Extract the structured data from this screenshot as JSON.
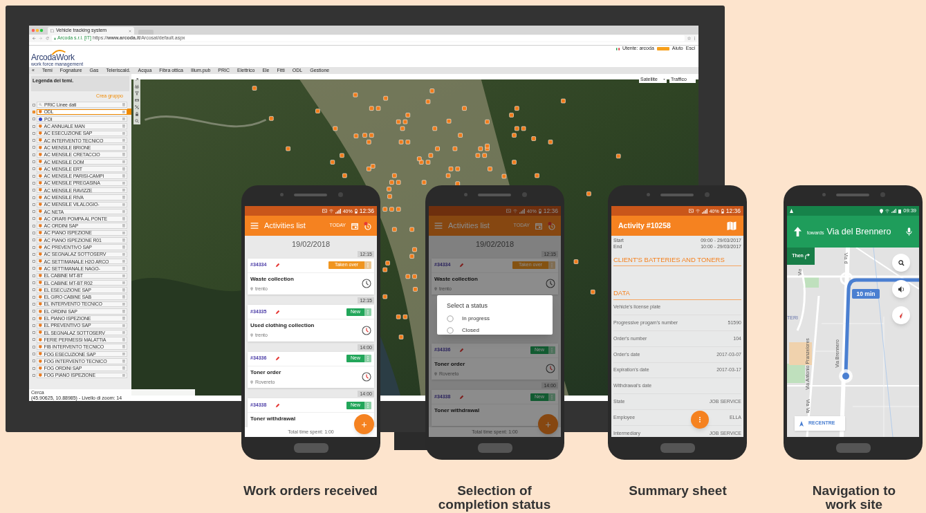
{
  "desktop": {
    "browser_tab": "Vehicle tracking system",
    "site_identity": "Arcoda s.r.l. [IT]",
    "url": "https://**www.arcoda.it**/Arcosat/default.aspx",
    "user_label": "Utente: arcoda",
    "help": "Aiuto",
    "exit": "Esci",
    "logo": {
      "name": "Arcoda",
      "product": "Work",
      "tagline": "work force management"
    },
    "menu": [
      "«",
      "Temi",
      "Fognature",
      "Gas",
      "Teleriscald.",
      "Acqua",
      "Fibra ottica",
      "Illum.pub",
      "PRIC",
      "Elettrico",
      "Ele",
      "Fitti",
      "ODL",
      "Gestione"
    ],
    "legend_title": "Legenda dei temi.",
    "create_group": "Crea gruppo",
    "layers": [
      {
        "label": "PRIC Linee dati",
        "kind": "search",
        "checked": false,
        "selected": false
      },
      {
        "label": "ODL",
        "kind": "marker",
        "checked": true,
        "selected": true
      },
      {
        "label": "POI",
        "kind": "dot",
        "color": "#2b3fc4",
        "checked": false,
        "selected": false
      },
      {
        "label": "AC ANNUALE MAN",
        "kind": "marker",
        "checked": false,
        "selected": false
      },
      {
        "label": "AC ESECUZIONE SAP",
        "kind": "marker",
        "checked": false,
        "selected": false
      },
      {
        "label": "AC INTERVENTO TECNICO",
        "kind": "marker",
        "checked": false,
        "selected": false
      },
      {
        "label": "AC MENSILE BRIONE",
        "kind": "marker",
        "checked": false,
        "selected": false
      },
      {
        "label": "AC MENSILE CRETACCIO",
        "kind": "marker",
        "checked": false,
        "selected": false
      },
      {
        "label": "AC MENSILE DOM",
        "kind": "marker",
        "checked": false,
        "selected": false
      },
      {
        "label": "AC MENSILE ERT",
        "kind": "marker",
        "checked": false,
        "selected": false
      },
      {
        "label": "AC MENSILE PARISI-CAMPI",
        "kind": "marker",
        "checked": false,
        "selected": false
      },
      {
        "label": "AC MENSILE PREGASINA",
        "kind": "marker",
        "checked": false,
        "selected": false
      },
      {
        "label": "AC MENSILE RAVIZZE",
        "kind": "marker",
        "checked": false,
        "selected": false
      },
      {
        "label": "AC MENSILE RIVA",
        "kind": "marker",
        "checked": false,
        "selected": false
      },
      {
        "label": "AC MENSILE VILALOGIO-",
        "kind": "marker",
        "checked": false,
        "selected": false
      },
      {
        "label": "AC NETA",
        "kind": "marker",
        "checked": false,
        "selected": false
      },
      {
        "label": "AC ORARI POMPA AL PONTE",
        "kind": "marker",
        "checked": false,
        "selected": false
      },
      {
        "label": "AC ORDINI SAP",
        "kind": "marker",
        "checked": false,
        "selected": false
      },
      {
        "label": "AC PIANO ISPEZIONE",
        "kind": "marker",
        "checked": false,
        "selected": false
      },
      {
        "label": "AC PIANO ISPEZIONE R01",
        "kind": "marker",
        "checked": false,
        "selected": false
      },
      {
        "label": "AC PREVENTIVO SAP",
        "kind": "marker",
        "checked": false,
        "selected": false
      },
      {
        "label": "AC SEGNALAZ SOTTOSERV",
        "kind": "marker",
        "checked": false,
        "selected": false
      },
      {
        "label": "AC SETTIMANALE H2O ARCO",
        "kind": "marker",
        "checked": false,
        "selected": false
      },
      {
        "label": "AC SETTIMANALE NAGO-",
        "kind": "marker",
        "checked": false,
        "selected": false
      },
      {
        "label": "EL CABINE MT-BT",
        "kind": "marker",
        "checked": false,
        "selected": false
      },
      {
        "label": "EL CABINE MT-BT R02",
        "kind": "marker",
        "checked": false,
        "selected": false
      },
      {
        "label": "EL ESECUZIONE SAP",
        "kind": "marker",
        "checked": false,
        "selected": false
      },
      {
        "label": "EL GIRO CABINE SAB",
        "kind": "marker",
        "checked": false,
        "selected": false
      },
      {
        "label": "EL INTERVENTO TECNICO",
        "kind": "marker",
        "checked": false,
        "selected": false
      },
      {
        "label": "EL ORDINI SAP",
        "kind": "marker",
        "checked": false,
        "selected": false
      },
      {
        "label": "EL PIANO ISPEZIONE",
        "kind": "marker",
        "checked": false,
        "selected": false
      },
      {
        "label": "EL PREVENTIVO SAP",
        "kind": "marker",
        "checked": false,
        "selected": false
      },
      {
        "label": "EL SEGNALAZ SOTTOSERV",
        "kind": "marker",
        "checked": false,
        "selected": false
      },
      {
        "label": "FERIE PERMESSI MALATTIA",
        "kind": "marker",
        "checked": false,
        "selected": false
      },
      {
        "label": "FIB INTERVENTO TECNICO",
        "kind": "marker",
        "checked": false,
        "selected": false
      },
      {
        "label": "FOG ESECUZIONE SAP",
        "kind": "marker",
        "checked": false,
        "selected": false
      },
      {
        "label": "FOG INTERVENTO TECNICO",
        "kind": "marker",
        "checked": false,
        "selected": false
      },
      {
        "label": "FOG ORDINI SAP",
        "kind": "marker",
        "checked": false,
        "selected": false
      },
      {
        "label": "FOG PIANO ISPEZIONE",
        "kind": "marker",
        "checked": false,
        "selected": false
      }
    ],
    "map_type": "Satellite",
    "traffic": "Traffico",
    "search_label": "Cerca",
    "coordinates": "(45.90625, 10.88985) - Livello di zoom: 14"
  },
  "work_orders_phone": {
    "status": {
      "battery": "40%",
      "time": "12:36"
    },
    "title": "Activities list",
    "today": "TODAY",
    "date": "19/02/2018",
    "footer": "Total time spent: 1:00",
    "fab": "+",
    "cards": [
      {
        "time": "12:15",
        "id": "#34334",
        "status": "Taken over",
        "kind": "taken",
        "title": "Waste collection",
        "place": "trento",
        "overdue": false
      },
      {
        "time": "12:15",
        "id": "#34335",
        "status": "New",
        "kind": "new",
        "title": "Used clothing collection",
        "place": "trento",
        "overdue": true
      },
      {
        "time": "14:00",
        "id": "#34336",
        "status": "New",
        "kind": "new",
        "title": "Toner order",
        "place": "Rovereto",
        "overdue": true
      },
      {
        "time": "14:00",
        "id": "#34338",
        "status": "New",
        "kind": "new",
        "title": "Toner withdrawal"
      }
    ]
  },
  "status_phone": {
    "status": {
      "battery": "40%",
      "time": "12:36"
    },
    "title": "Activities list",
    "today": "TODAY",
    "date": "19/02/2018",
    "footer": "Total time spent: 1:00",
    "fab": "+",
    "cards": [
      {
        "time": "12:15",
        "id": "#34334",
        "status": "Taken over",
        "kind": "taken",
        "title": "Waste collection",
        "place": "trento",
        "overdue": false
      },
      {
        "id": "#34336",
        "status": "New",
        "kind": "new",
        "title": "Toner order",
        "place": "Rovereto",
        "overdue": true
      },
      {
        "time": "14:00",
        "id": "#34338",
        "status": "New",
        "kind": "new",
        "title": "Toner withdrawal"
      }
    ],
    "dialog": {
      "title": "Select a status",
      "options": [
        {
          "label": "In progress",
          "selected": false
        },
        {
          "label": "Closed",
          "selected": false
        }
      ]
    }
  },
  "summary_phone": {
    "status": {
      "battery": "40%",
      "time": "12:36"
    },
    "title": "Activity #10258",
    "start_label": "Start",
    "start": "09:00 - 29/03/2017",
    "end_label": "End",
    "end": "10:00 - 29/03/2017",
    "heading": "CLIENT'S BATTERIES AND TONERS",
    "section": "DATA",
    "fields": [
      {
        "label": "Vehicle's license plate"
      },
      {
        "label": "Progressive progam's number",
        "value": "51590"
      },
      {
        "label": "Order's number",
        "value": "104"
      },
      {
        "label": "Order's date",
        "value": "2017-03-07"
      },
      {
        "label": "Expiration's date",
        "value": "2017-03-17"
      },
      {
        "label": "Withdrawal's date"
      },
      {
        "label": "State",
        "value": "JOB SERVICE"
      },
      {
        "label": "Employee",
        "value": "ELLA"
      },
      {
        "label": "Intermediary",
        "value": "JOB SERVICE"
      }
    ]
  },
  "navigation_phone": {
    "time": "09:39",
    "towards": "towards",
    "street": "Via del Brennero",
    "then": "Then",
    "eta": "10 min",
    "recentre": "RECENTRE",
    "map_labels": [
      "Via d",
      "Via",
      "TERI",
      "Via Antonio Pranzelores",
      "Via Brennero",
      "Via Va"
    ]
  },
  "captions": [
    "Work orders received",
    "Selection of completion status",
    "Summary sheet",
    "Navigation to work site"
  ]
}
